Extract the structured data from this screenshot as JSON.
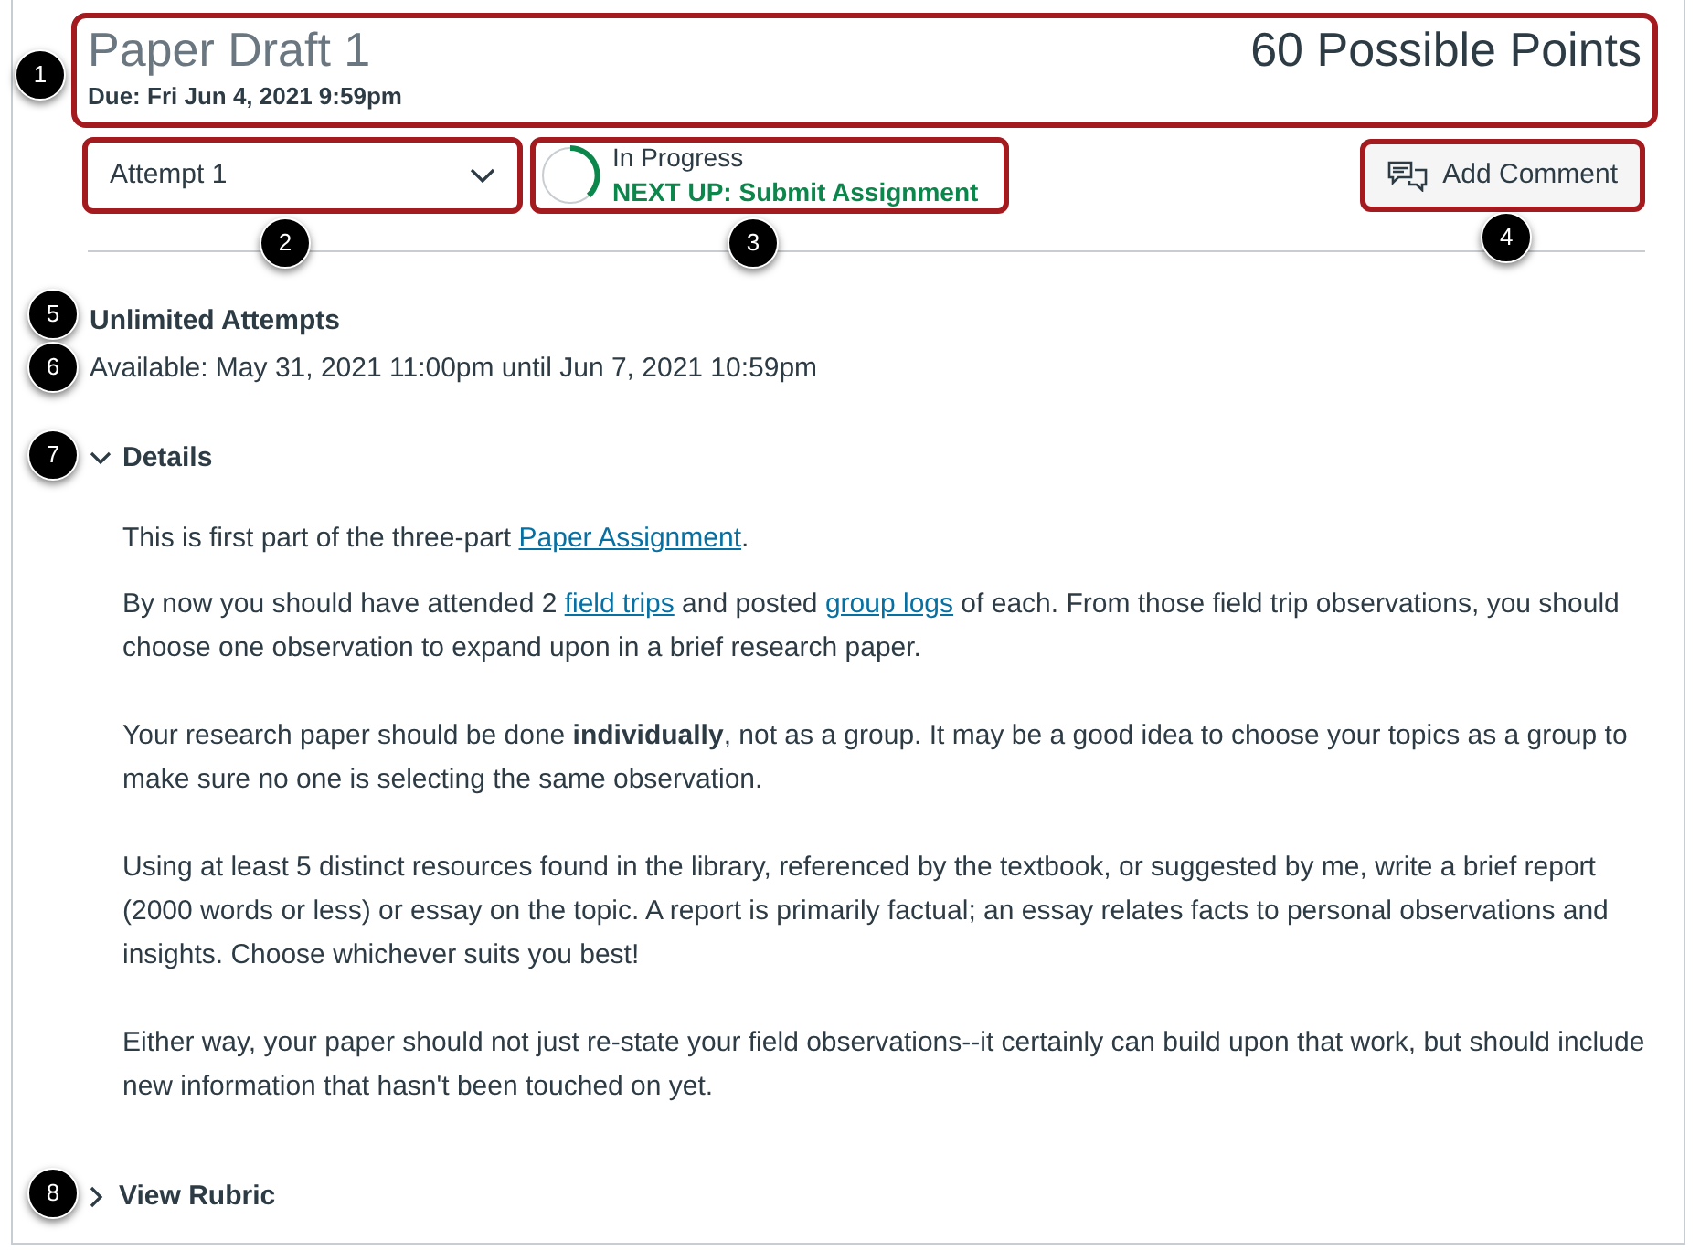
{
  "header": {
    "title": "Paper Draft 1",
    "due": "Due: Fri Jun 4, 2021 9:59pm",
    "points": "60 Possible Points",
    "callout": "1",
    "highlighted": true
  },
  "attempt_select": {
    "value": "Attempt 1",
    "callout": "2",
    "highlighted": true
  },
  "status": {
    "label": "In Progress",
    "next_up": "NEXT UP: Submit Assignment",
    "callout": "3",
    "highlighted": true
  },
  "add_comment_button": {
    "label": "Add Comment",
    "callout": "4",
    "highlighted": true
  },
  "attempts": {
    "text": "Unlimited Attempts",
    "callout": "5"
  },
  "availability": {
    "text": "Available: May 31, 2021 11:00pm until Jun 7, 2021 10:59pm",
    "callout": "6"
  },
  "details": {
    "label": "Details",
    "expanded": true,
    "callout": "7",
    "paragraphs": [
      [
        {
          "kind": "text",
          "text": "This is first part of the three-part "
        },
        {
          "kind": "link",
          "text": "Paper Assignment"
        },
        {
          "kind": "text",
          "text": "."
        }
      ],
      [
        {
          "kind": "text",
          "text": "By now you should have attended 2 "
        },
        {
          "kind": "link",
          "text": "field trips"
        },
        {
          "kind": "text",
          "text": " and posted "
        },
        {
          "kind": "link",
          "text": "group logs"
        },
        {
          "kind": "text",
          "text": " of each. From those field trip observations, you should choose one observation to expand upon in a brief research paper."
        }
      ],
      [
        {
          "kind": "text",
          "text": "Your research paper should be done **individually**, not as a group. It may be a good idea to choose your topics as a group to make sure no one is selecting the same observation."
        }
      ],
      [
        {
          "kind": "text",
          "text": "Using at least 5 distinct resources found in the library, referenced by the textbook, or suggested by me, write a brief report (2000 words or less) or essay on the topic. A report is primarily factual; an essay relates facts to personal observations and insights. Choose whichever suits you best!"
        }
      ],
      [
        {
          "kind": "text",
          "text": "Either way, your paper should not just re-state your field observations--it certainly can build upon that work, but should include new information that hasn't been touched on yet."
        }
      ]
    ]
  },
  "rubric": {
    "label": "View Rubric",
    "expanded": false,
    "callout": "8"
  }
}
